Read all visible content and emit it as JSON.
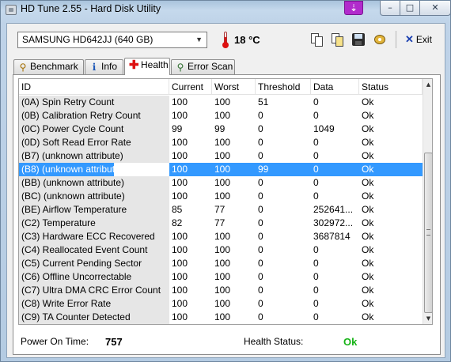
{
  "window": {
    "title": "HD Tune 2.55 - Hard Disk Utility"
  },
  "toolbar": {
    "drive": "SAMSUNG HD642JJ (640 GB)",
    "temperature": "18 °C",
    "exit_label": "Exit"
  },
  "tabs": [
    {
      "label": "Benchmark"
    },
    {
      "label": "Info"
    },
    {
      "label": "Health"
    },
    {
      "label": "Error Scan"
    }
  ],
  "table": {
    "columns": [
      "ID",
      "Current",
      "Worst",
      "Threshold",
      "Data",
      "Status"
    ],
    "selected_row": 5,
    "rows": [
      {
        "id": "(0A) Spin Retry Count",
        "current": "100",
        "worst": "100",
        "threshold": "51",
        "data": "0",
        "status": "Ok"
      },
      {
        "id": "(0B) Calibration Retry Count",
        "current": "100",
        "worst": "100",
        "threshold": "0",
        "data": "0",
        "status": "Ok"
      },
      {
        "id": "(0C) Power Cycle Count",
        "current": "99",
        "worst": "99",
        "threshold": "0",
        "data": "1049",
        "status": "Ok"
      },
      {
        "id": "(0D) Soft Read Error Rate",
        "current": "100",
        "worst": "100",
        "threshold": "0",
        "data": "0",
        "status": "Ok"
      },
      {
        "id": "(B7) (unknown attribute)",
        "current": "100",
        "worst": "100",
        "threshold": "0",
        "data": "0",
        "status": "Ok"
      },
      {
        "id": "(B8) (unknown attribute)",
        "current": "100",
        "worst": "100",
        "threshold": "99",
        "data": "0",
        "status": "Ok"
      },
      {
        "id": "(BB) (unknown attribute)",
        "current": "100",
        "worst": "100",
        "threshold": "0",
        "data": "0",
        "status": "Ok"
      },
      {
        "id": "(BC) (unknown attribute)",
        "current": "100",
        "worst": "100",
        "threshold": "0",
        "data": "0",
        "status": "Ok"
      },
      {
        "id": "(BE) Airflow Temperature",
        "current": "85",
        "worst": "77",
        "threshold": "0",
        "data": "252641...",
        "status": "Ok"
      },
      {
        "id": "(C2) Temperature",
        "current": "82",
        "worst": "77",
        "threshold": "0",
        "data": "302972...",
        "status": "Ok"
      },
      {
        "id": "(C3) Hardware ECC Recovered",
        "current": "100",
        "worst": "100",
        "threshold": "0",
        "data": "3687814",
        "status": "Ok"
      },
      {
        "id": "(C4) Reallocated Event Count",
        "current": "100",
        "worst": "100",
        "threshold": "0",
        "data": "0",
        "status": "Ok"
      },
      {
        "id": "(C5) Current Pending Sector",
        "current": "100",
        "worst": "100",
        "threshold": "0",
        "data": "0",
        "status": "Ok"
      },
      {
        "id": "(C6) Offline Uncorrectable",
        "current": "100",
        "worst": "100",
        "threshold": "0",
        "data": "0",
        "status": "Ok"
      },
      {
        "id": "(C7) Ultra DMA CRC Error Count",
        "current": "100",
        "worst": "100",
        "threshold": "0",
        "data": "0",
        "status": "Ok"
      },
      {
        "id": "(C8) Write Error Rate",
        "current": "100",
        "worst": "100",
        "threshold": "0",
        "data": "0",
        "status": "Ok"
      },
      {
        "id": "(C9) TA Counter Detected",
        "current": "100",
        "worst": "100",
        "threshold": "0",
        "data": "0",
        "status": "Ok"
      }
    ]
  },
  "footer": {
    "power_on_label": "Power On Time:",
    "power_on_value": "757",
    "health_label": "Health Status:",
    "health_value": "Ok"
  },
  "colors": {
    "selection": "#3399ff",
    "health_ok": "#17b317",
    "temperature_icon": "#dd1111"
  },
  "icons": [
    "app-icon",
    "download-icon",
    "minimize-icon",
    "maximize-icon",
    "close-icon",
    "thermometer-icon",
    "copy-text-icon",
    "copy-screenshot-icon",
    "save-icon",
    "options-icon",
    "exit-icon",
    "benchmark-icon",
    "info-icon",
    "health-icon",
    "error-scan-icon"
  ]
}
